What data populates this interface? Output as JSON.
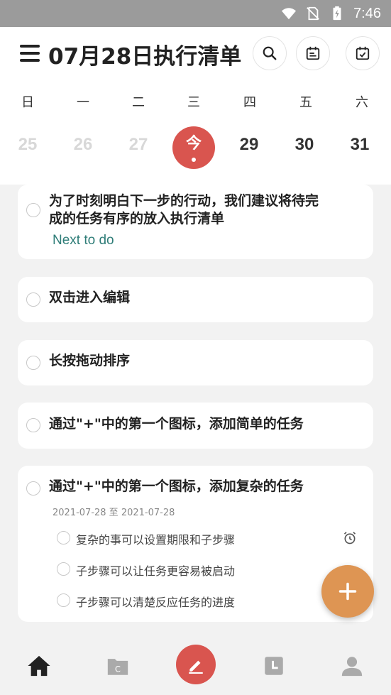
{
  "status": {
    "time": "7:46"
  },
  "header": {
    "title": "07月28日执行清单"
  },
  "calendar": {
    "weekdays": [
      "日",
      "一",
      "二",
      "三",
      "四",
      "五",
      "六"
    ],
    "dates": [
      "25",
      "26",
      "27",
      "今",
      "29",
      "30",
      "31"
    ]
  },
  "tasks": {
    "t1": {
      "title_line1": "为了时刻明白下一步的行动，我们建议将待完",
      "title_line2": "成的任务有序的放入执行清单",
      "tag": "Next to do"
    },
    "t2": {
      "title": "双击进入编辑"
    },
    "t3": {
      "title": "长按拖动排序"
    },
    "t4": {
      "title": "通过\"+\"中的第一个图标，添加简单的任务"
    },
    "t5": {
      "title": "通过\"+\"中的第一个图标，添加复杂的任务",
      "daterange": "2021-07-28 至 2021-07-28",
      "subtasks": [
        "复杂的事可以设置期限和子步骤",
        "子步骤可以让任务更容易被启动",
        "子步骤可以清楚反应任务的进度"
      ]
    }
  },
  "colors": {
    "accent_red": "#d9554f",
    "fab_orange": "#de9553",
    "tag_teal": "#2f7d78"
  }
}
